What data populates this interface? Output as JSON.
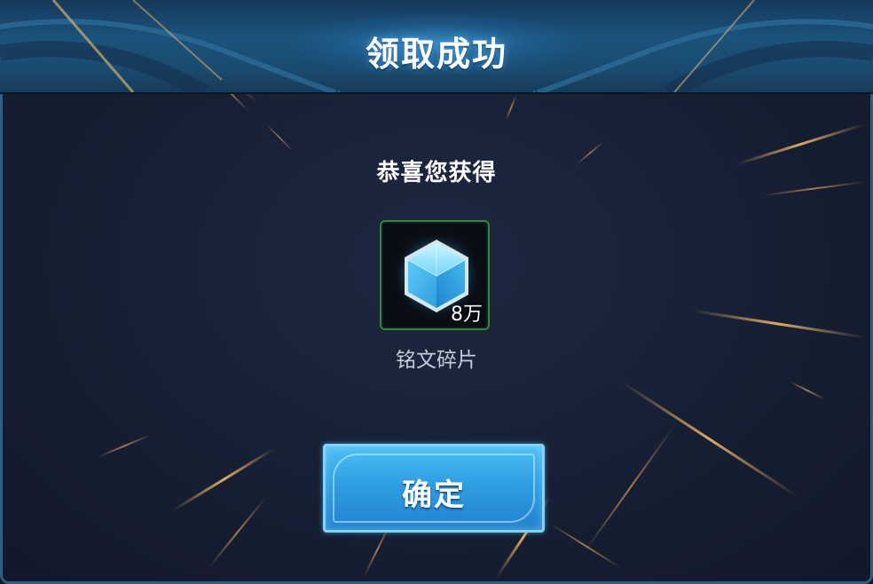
{
  "dialog": {
    "title": "领取成功",
    "subtitle": "恭喜您获得",
    "reward": {
      "name": "铭文碎片",
      "quantity": "8万",
      "icon": "blue-crystal-icon"
    },
    "confirm_label": "确定"
  },
  "colors": {
    "header_blue": "#1b527a",
    "background": "#161f33",
    "button_blue": "#2f9ee3",
    "tile_border_green": "#2b8a3e",
    "ray_gold": "#f0b060"
  }
}
